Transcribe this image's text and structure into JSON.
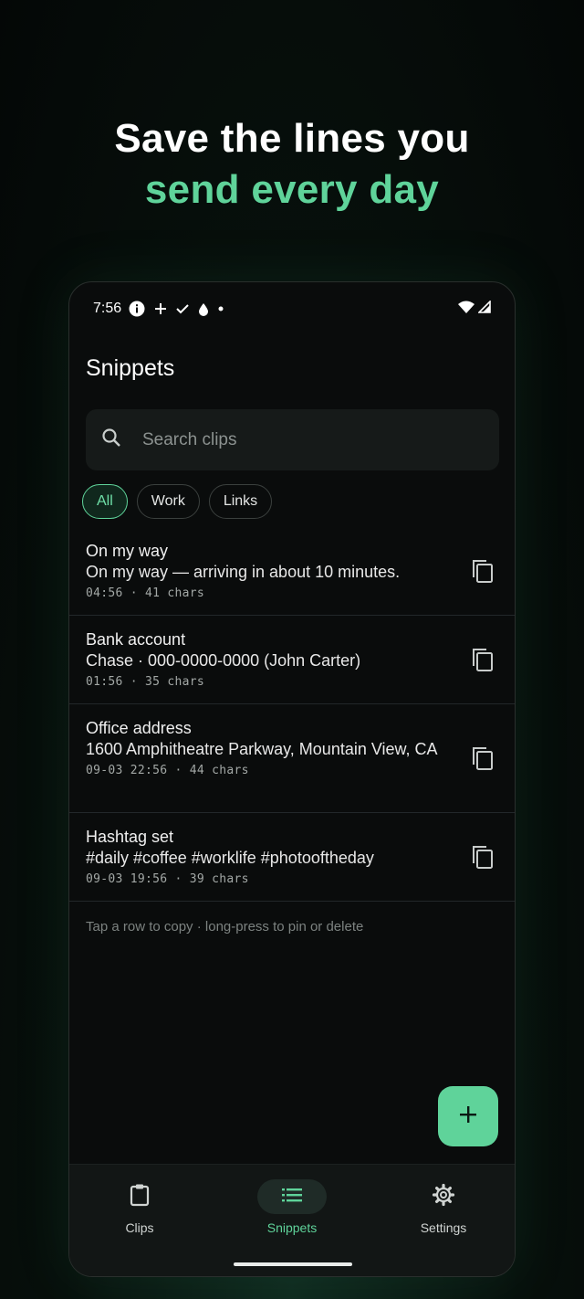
{
  "headline": {
    "line1": "Save the lines you",
    "line2": "send every day"
  },
  "status_bar": {
    "time": "7:56",
    "icons": [
      "info-icon",
      "plus-icon",
      "check-icon",
      "drop-icon",
      "dot-icon",
      "wifi-icon",
      "signal-icon"
    ]
  },
  "app": {
    "title": "Snippets",
    "search_placeholder": "Search clips",
    "chips": [
      {
        "label": "All",
        "selected": true
      },
      {
        "label": "Work",
        "selected": false
      },
      {
        "label": "Links",
        "selected": false
      }
    ],
    "snippets": [
      {
        "title": "On my way",
        "text": "On my way — arriving in about 10 minutes.",
        "meta": "04:56 · 41 chars"
      },
      {
        "title": "Bank account",
        "text": "Chase · 000-0000-0000 (John Carter)",
        "meta": "01:56 · 35 chars"
      },
      {
        "title": "Office address",
        "text": "1600 Amphitheatre Parkway, Mountain View, CA",
        "meta": "09-03 22:56 · 44 chars"
      },
      {
        "title": "Hashtag set",
        "text": "#daily #coffee #worklife #photooftheday",
        "meta": "09-03 19:56 · 39 chars"
      }
    ],
    "hint": "Tap a row to copy · long-press to pin or delete",
    "fab_icon": "plus-icon"
  },
  "bottom_nav": {
    "items": [
      {
        "label": "Clips",
        "icon": "clipboard-icon",
        "active": false
      },
      {
        "label": "Snippets",
        "icon": "list-icon",
        "active": true
      },
      {
        "label": "Settings",
        "icon": "gear-icon",
        "active": false
      }
    ]
  },
  "colors": {
    "accent": "#5fd39a",
    "background": "#0a0c0c",
    "surface": "#161a19"
  }
}
